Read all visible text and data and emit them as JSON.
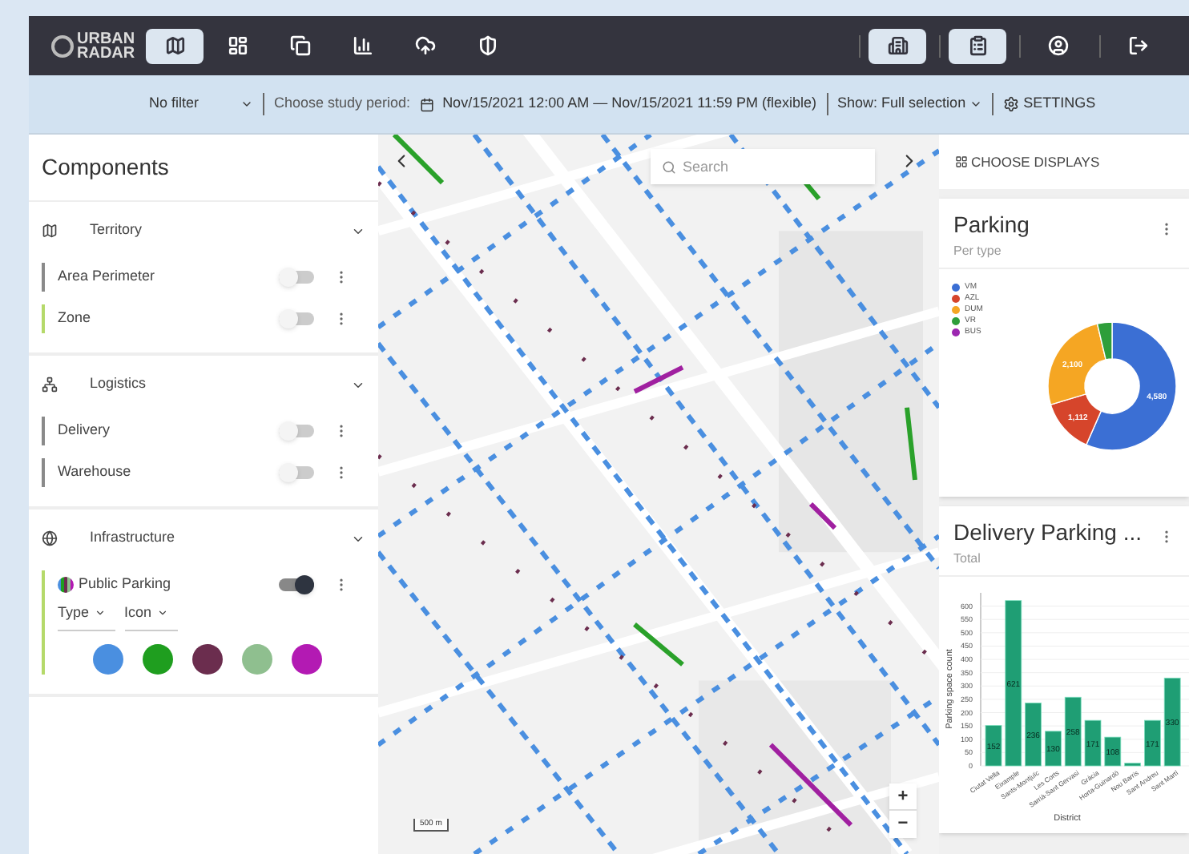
{
  "nav": {
    "logo_top": "URBAN",
    "logo_bottom": "RADAR",
    "tabs": [
      {
        "kind": "map",
        "selected": true
      },
      {
        "kind": "dashboard",
        "selected": false
      },
      {
        "kind": "layers",
        "selected": false
      },
      {
        "kind": "chart",
        "selected": false
      },
      {
        "kind": "cloud",
        "selected": false
      },
      {
        "kind": "shield",
        "selected": false
      }
    ],
    "actions": [
      {
        "kind": "building",
        "selected": true
      },
      {
        "kind": "clipboard",
        "selected": true
      },
      {
        "kind": "user",
        "selected": false
      },
      {
        "kind": "logout",
        "selected": false
      }
    ]
  },
  "filter_bar": {
    "filter": "No filter",
    "period_label": "Choose study period:",
    "period_value": "Nov/15/2021 12:00 AM — Nov/15/2021 11:59 PM (flexible)",
    "show": "Show: Full selection",
    "settings": "SETTINGS"
  },
  "components": {
    "title": "Components",
    "sections": [
      {
        "title": "Territory",
        "kind": "map",
        "expanded": true,
        "layers": [
          {
            "name": "Area Perimeter",
            "on": false,
            "color": "#8a8a8a"
          },
          {
            "name": "Zone",
            "on": false,
            "color": "#b5d96a"
          }
        ]
      },
      {
        "title": "Logistics",
        "kind": "hub",
        "expanded": true,
        "layers": [
          {
            "name": "Delivery",
            "on": false,
            "color": "#8a8a8a"
          },
          {
            "name": "Warehouse",
            "on": false,
            "color": "#8a8a8a"
          }
        ]
      },
      {
        "title": "Infrastructure",
        "kind": "globe",
        "expanded": true,
        "layers": [
          {
            "name": "Public Parking",
            "on": true,
            "color": "#b5d96a",
            "filters": [
              "Type",
              "Icon"
            ],
            "swatches": [
              {
                "color": "#4a8fe0"
              },
              {
                "color": "#1f9e1f"
              },
              {
                "color": "#6b2d4e"
              },
              {
                "color": "#8fbf8f"
              },
              {
                "color": "#b31ab3"
              }
            ]
          }
        ]
      }
    ]
  },
  "map": {
    "search": {
      "placeholder": "Search"
    },
    "scale": "500 m",
    "zoom_in": "+",
    "zoom_out": "−"
  },
  "displays": {
    "choose": "CHOOSE DISPLAYS",
    "cards": [
      {
        "title": "Parking",
        "subtitle": "Per type",
        "chart_data": {
          "type": "donut",
          "categories": [
            "VM",
            "AZL",
            "DUM",
            "VR",
            "BUS"
          ],
          "values": [
            4580,
            1112,
            2100,
            300,
            0
          ],
          "legend": "top-left",
          "colors": [
            "#3b6fd4",
            "#d6452b",
            "#f5a623",
            "#2e9e3a",
            "#9c27b0"
          ],
          "value_labels": [
            "4,580",
            "1,112",
            "2,100",
            null,
            null
          ]
        }
      },
      {
        "title": "Delivery Parking ...",
        "subtitle": "Total",
        "chart_data": {
          "type": "bar",
          "ylabel": "Parking space count",
          "xlabel": "District",
          "categories": [
            "Ciutat Vella",
            "Eixample",
            "Sants-Montjuïc",
            "Les Corts",
            "Sarrià-Sant Gervasi",
            "Gràcia",
            "Horta-Guinardó",
            "Nou Barris",
            "Sant Andreu",
            "Sant Martí"
          ],
          "series": [
            {
              "color": "#1f9e74",
              "values": [
                152,
                621,
                236,
                130,
                258,
                171,
                108,
                10,
                171,
                330
              ]
            }
          ],
          "grid": true,
          "ylim": [
            0,
            650
          ],
          "yticks": [
            0,
            50,
            100,
            150,
            200,
            250,
            300,
            350,
            400,
            450,
            500,
            550,
            600
          ],
          "value_labels": [
            "152",
            "621",
            "236",
            "130",
            "258",
            "171",
            "108",
            null,
            "171",
            "330"
          ]
        }
      }
    ]
  }
}
